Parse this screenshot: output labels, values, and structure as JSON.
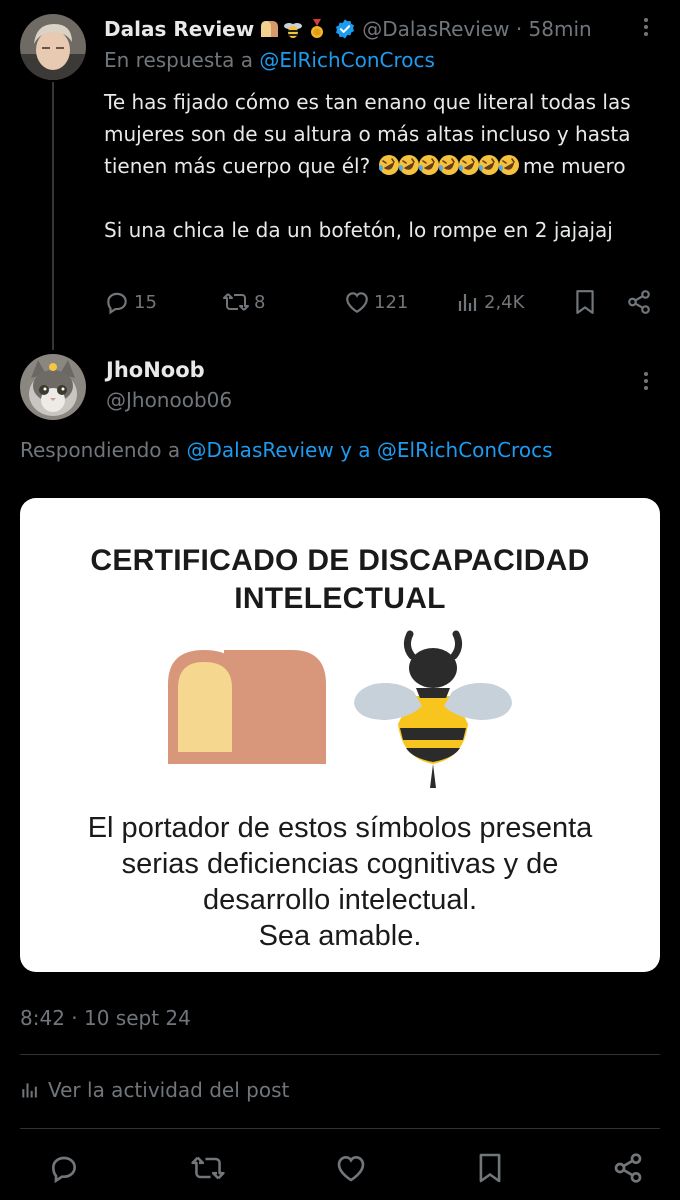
{
  "colors": {
    "background": "#000000",
    "text": "#e7e9ea",
    "muted": "#71767b",
    "link": "#1d9bf0",
    "card_bg": "#ffffff"
  },
  "post1": {
    "display_name": "Dalas Review",
    "name_emojis": [
      "bread-emoji",
      "bee-emoji",
      "medal-emoji"
    ],
    "verified": true,
    "handle": "@DalasReview",
    "time": "58min",
    "reply_prefix": "En respuesta a",
    "reply_handle": "@ElRichConCrocs",
    "text_line1": "Te has fijado cómo es tan enano que literal todas las mujeres son de su altura o más altas incluso y hasta tienen más cuerpo que él?",
    "laugh_emoji_count": 7,
    "text_line1_end": "me muero",
    "text_line2": "Si una chica le da un bofetón, lo rompe en 2 jajajaj",
    "stats": {
      "replies": "15",
      "reposts": "8",
      "likes": "121",
      "views": "2,4K"
    }
  },
  "post2": {
    "display_name": "JhoNoob",
    "handle": "@Jhonoob06",
    "responding_prefix": "Respondiendo a",
    "responding_handle_1": "@DalasReview",
    "responding_conjunction": "y a",
    "responding_handle_2": "@ElRichConCrocs",
    "image": {
      "title_line1": "CERTIFICADO DE DISCAPACIDAD",
      "title_line2": "INTELECTUAL",
      "body_line1": "El portador de estos símbolos presenta",
      "body_line2": "serias deficiencias cognitivas y de",
      "body_line3": "desarrollo intelectual.",
      "body_line4": "Sea amable."
    },
    "timestamp": "8:42 · 10 sept 24",
    "activity_label": "Ver la actividad del post"
  }
}
